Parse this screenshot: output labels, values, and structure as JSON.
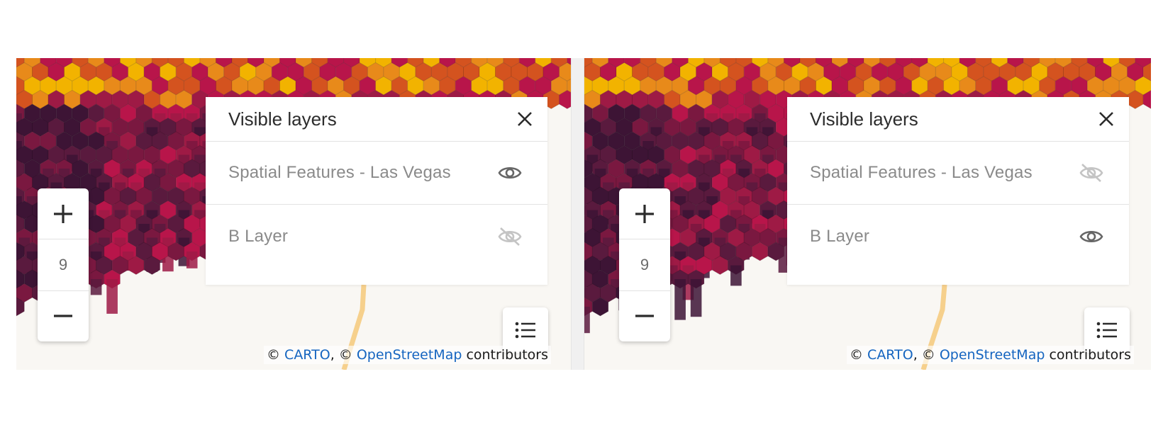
{
  "colors": {
    "link": "#1565c0",
    "panel_bg": "#ffffff",
    "map_bg": "#f9f7f3",
    "hex_palette": [
      "#3d1435",
      "#5a1a3e",
      "#7a1840",
      "#9e1a45",
      "#b8154a",
      "#d4531f",
      "#e88a1a",
      "#f2b300"
    ],
    "road": "#f6d08c"
  },
  "maps": [
    {
      "zoom": {
        "plus_icon": "plus-icon",
        "level": "9",
        "minus_icon": "minus-icon"
      },
      "layers_panel": {
        "title": "Visible layers",
        "close_icon": "close-icon",
        "layers": [
          {
            "label": "Spatial Features - Las Vegas",
            "visible": true,
            "icon": "eye-icon"
          },
          {
            "label": "B Layer",
            "visible": false,
            "icon": "eye-off-icon"
          }
        ]
      },
      "legend_toggle_icon": "list-icon",
      "attribution": {
        "prefix": "© ",
        "carto": "CARTO",
        "mid": ", © ",
        "osm": "OpenStreetMap",
        "suffix": " contributors"
      }
    },
    {
      "zoom": {
        "plus_icon": "plus-icon",
        "level": "9",
        "minus_icon": "minus-icon"
      },
      "layers_panel": {
        "title": "Visible layers",
        "close_icon": "close-icon",
        "layers": [
          {
            "label": "Spatial Features - Las Vegas",
            "visible": false,
            "icon": "eye-off-icon"
          },
          {
            "label": "B Layer",
            "visible": true,
            "icon": "eye-icon"
          }
        ]
      },
      "legend_toggle_icon": "list-icon",
      "attribution": {
        "prefix": "© ",
        "carto": "CARTO",
        "mid": ", © ",
        "osm": "OpenStreetMap",
        "suffix": " contributors"
      }
    }
  ]
}
